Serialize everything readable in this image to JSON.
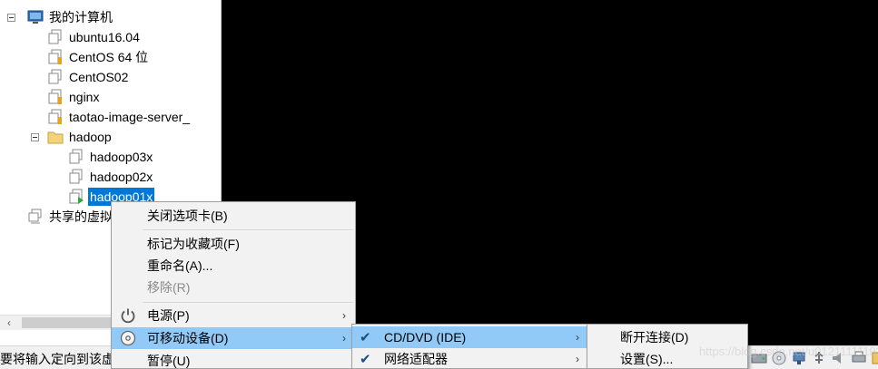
{
  "tree": {
    "root_label": "我的计算机",
    "vms": [
      "ubuntu16.04",
      "CentOS 64 位",
      "CentOS02",
      "nginx",
      "taotao-image-server_"
    ],
    "folder_label": "hadoop",
    "folder_vms": [
      "hadoop03x",
      "hadoop02x",
      "hadoop01x"
    ],
    "selected": "hadoop01x",
    "shared_label": "共享的虚拟"
  },
  "status_bar": {
    "text": "要将输入定向到该虚"
  },
  "context_menu": {
    "items": [
      {
        "label": "关闭选项卡(B)"
      },
      {
        "label": "标记为收藏项(F)"
      },
      {
        "label": "重命名(A)..."
      },
      {
        "label": "移除(R)",
        "disabled": true
      },
      {
        "label": "电源(P)",
        "icon": "power-icon",
        "submenu": true
      },
      {
        "label": "可移动设备(D)",
        "icon": "disc-icon",
        "submenu": true,
        "highlighted": true
      },
      {
        "label": "暂停(U)"
      }
    ]
  },
  "removable_menu": {
    "items": [
      {
        "label": "CD/DVD (IDE)",
        "checked": true,
        "submenu": true,
        "highlighted": true
      },
      {
        "label": "网络适配器",
        "checked": true,
        "submenu": true
      }
    ]
  },
  "cddvd_menu": {
    "items": [
      {
        "label": "断开连接(D)"
      },
      {
        "label": "设置(S)..."
      }
    ]
  },
  "watermark": "https://blog.csdn.net/u012111111938"
}
